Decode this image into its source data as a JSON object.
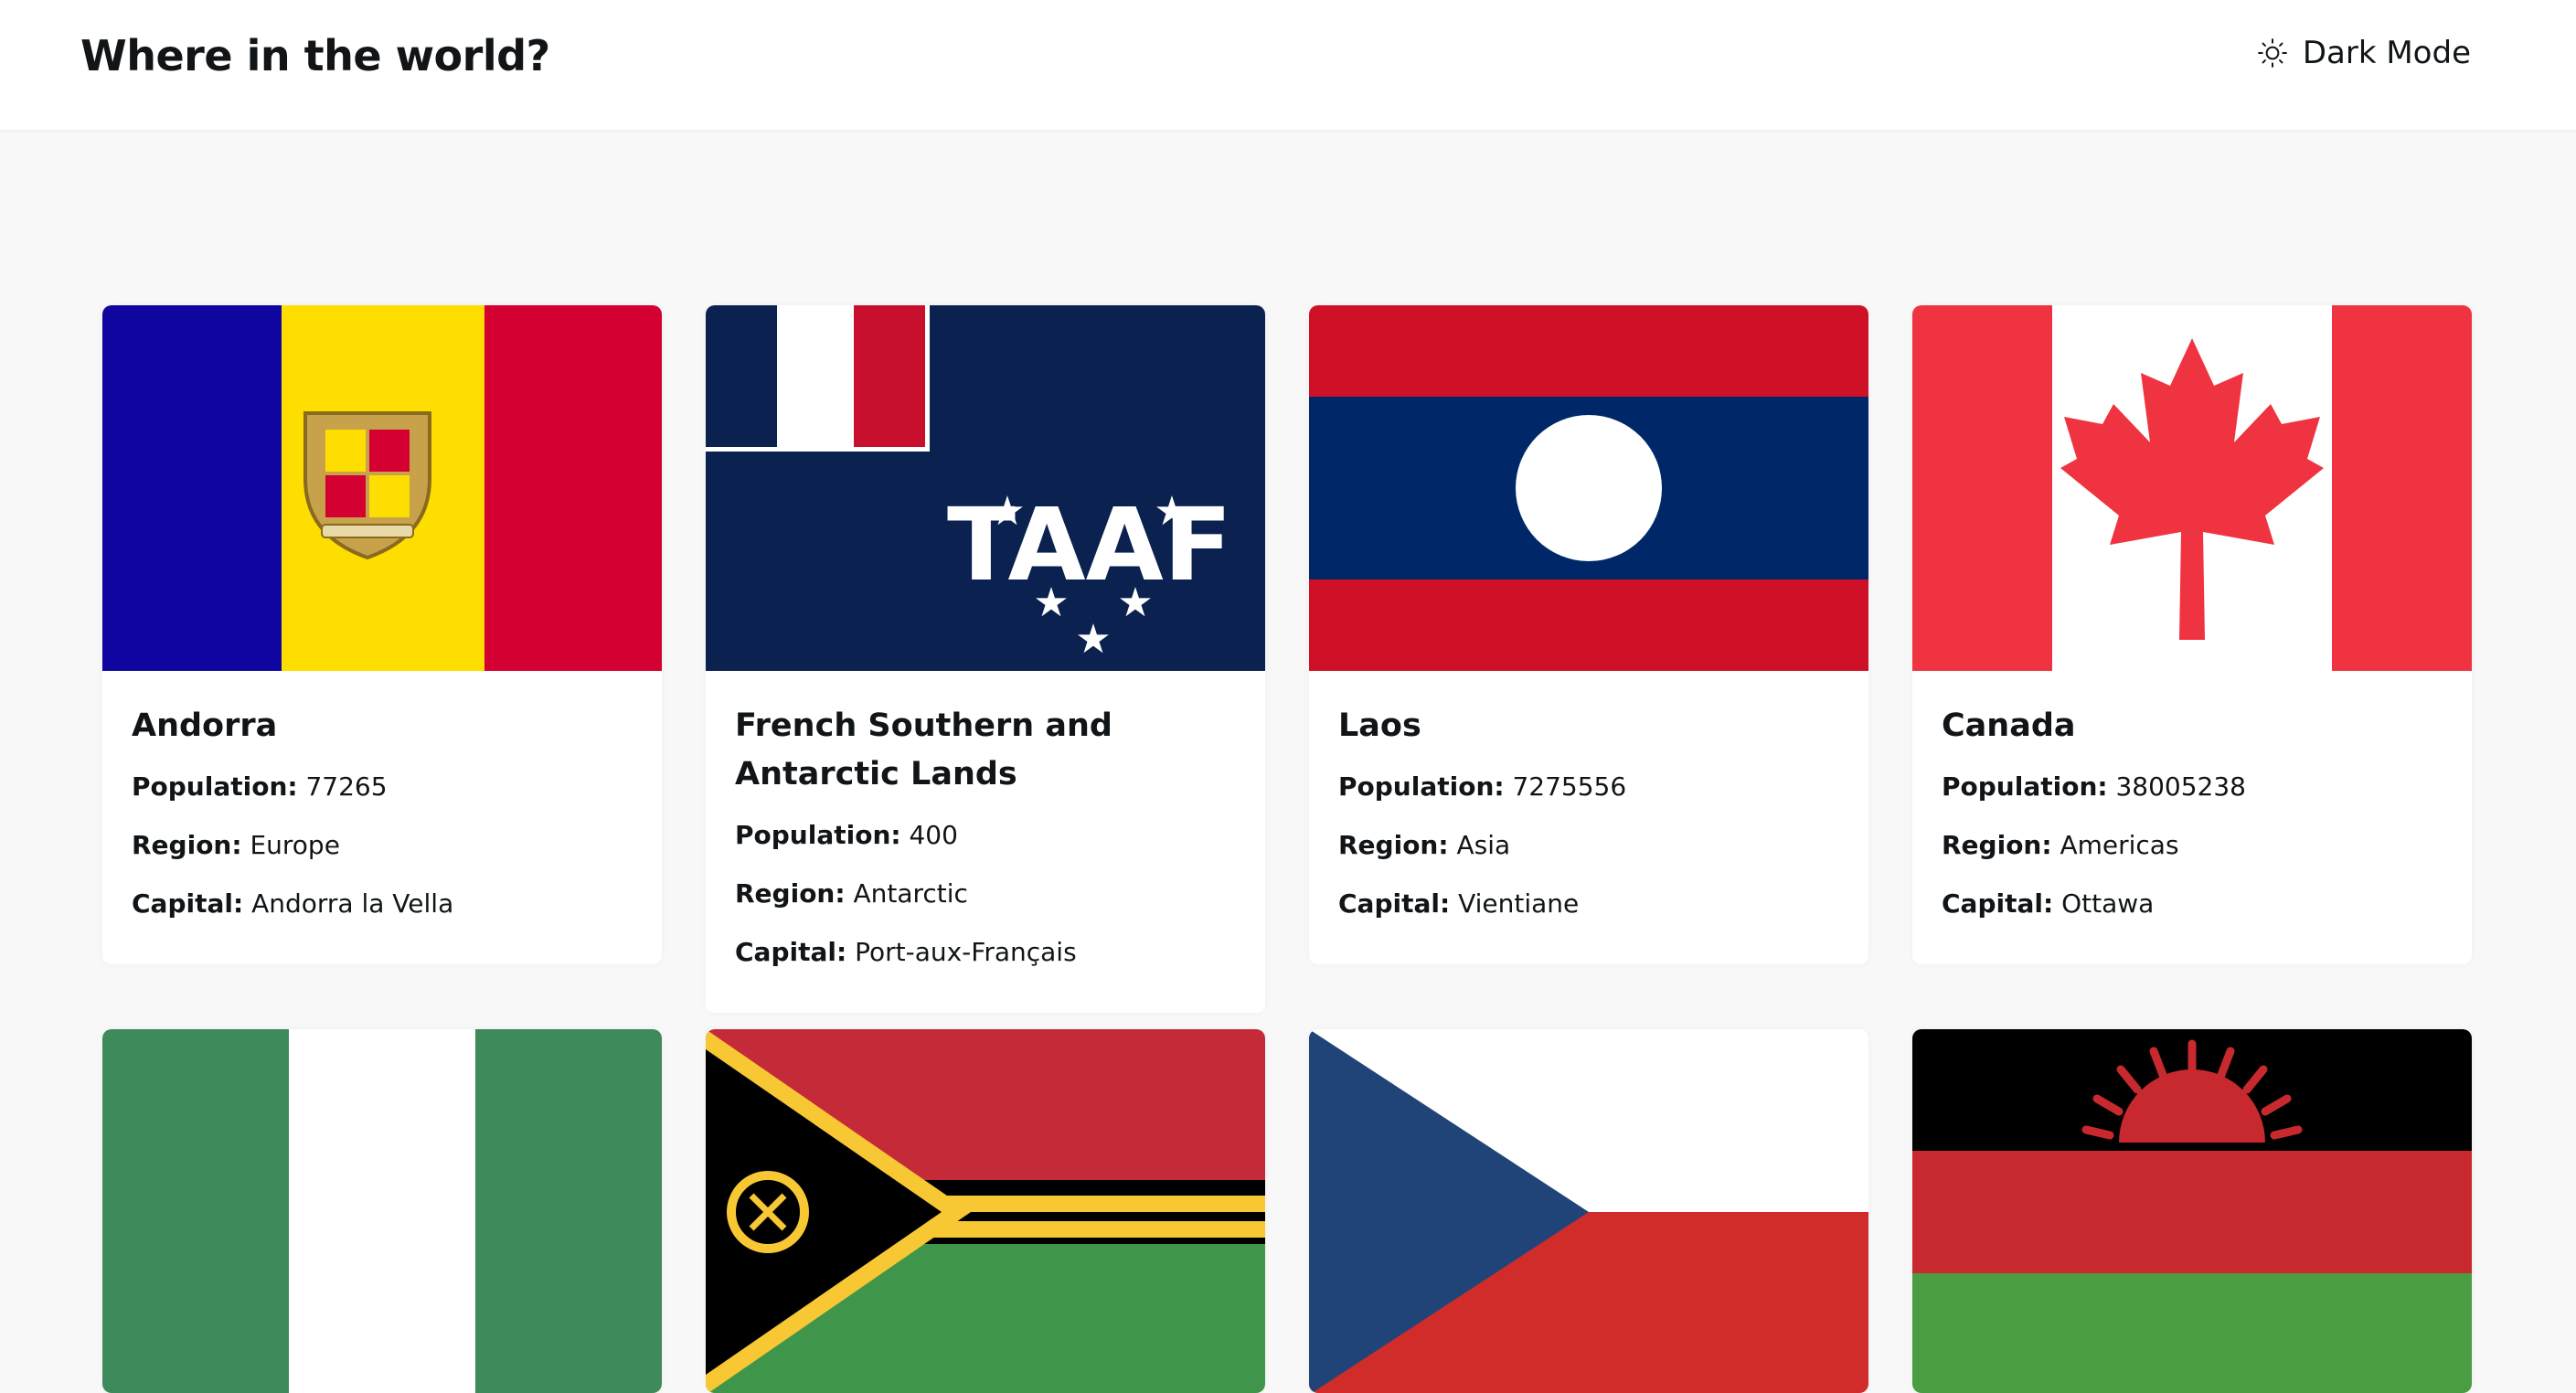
{
  "header": {
    "title": "Where in the world?",
    "mode_label": "Dark Mode",
    "mode_icon": "sun-icon"
  },
  "labels": {
    "population": "Population:",
    "region": "Region:",
    "capital": "Capital:"
  },
  "countries": [
    {
      "name": "Andorra",
      "population": "77265",
      "region": "Europe",
      "capital": "Andorra la Vella"
    },
    {
      "name": "French Southern and Antarctic Lands",
      "population": "400",
      "region": "Antarctic",
      "capital": "Port-aux-Français"
    },
    {
      "name": "Laos",
      "population": "7275556",
      "region": "Asia",
      "capital": "Vientiane"
    },
    {
      "name": "Canada",
      "population": "38005238",
      "region": "Americas",
      "capital": "Ottawa"
    }
  ],
  "colors": {
    "background": "#f8f8f8",
    "card": "#ffffff",
    "text": "#111517"
  }
}
